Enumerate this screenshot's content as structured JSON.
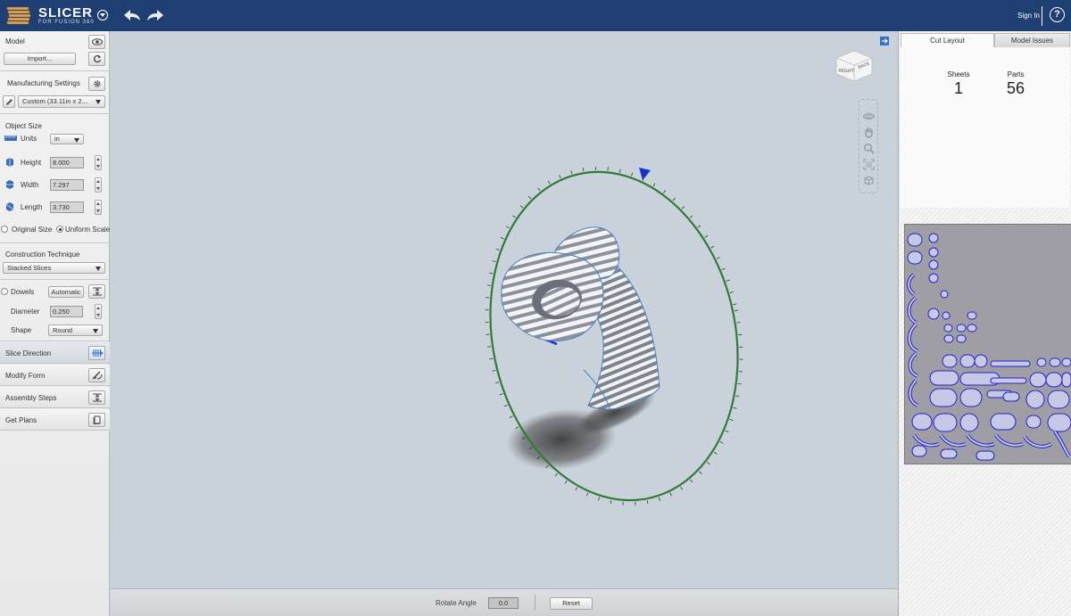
{
  "app": {
    "title": "SLICER",
    "subtitle": "FOR FUSION 360",
    "sign_in": "Sign In",
    "help": "?"
  },
  "left_panel": {
    "model": {
      "label": "Model",
      "import_label": "Import..."
    },
    "manufacturing": {
      "label": "Manufacturing Settings",
      "preset": "Custom (33.11in x 2..."
    },
    "object_size": {
      "label": "Object Size",
      "units_label": "Units",
      "units_value": "in",
      "height_label": "Height",
      "height_value": "8.000",
      "width_label": "Width",
      "width_value": "7.297",
      "length_label": "Length",
      "length_value": "3.730",
      "original_size": "Original Size",
      "uniform_scale": "Uniform Scale"
    },
    "construction": {
      "label": "Construction Technique",
      "value": "Stacked Slices"
    },
    "dowels": {
      "label": "Dowels",
      "mode": "Automatic",
      "diameter_label": "Diameter",
      "diameter_value": "0.250",
      "shape_label": "Shape",
      "shape_value": "Round"
    },
    "nav": [
      {
        "label": "Slice Direction",
        "icon": "slice-direction-icon"
      },
      {
        "label": "Modify Form",
        "icon": "modify-form-icon"
      },
      {
        "label": "Assembly Steps",
        "icon": "assembly-steps-icon"
      },
      {
        "label": "Get Plans",
        "icon": "get-plans-icon"
      }
    ]
  },
  "viewport": {
    "viewcube": {
      "right": "RIGHT",
      "back": "BACK"
    },
    "rotate_label": "Rotate Angle",
    "rotate_value": "0.0",
    "reset_label": "Reset"
  },
  "right_panel": {
    "tabs": [
      "Cut Layout",
      "Model Issues"
    ],
    "sheets_label": "Sheets",
    "sheets_value": "1",
    "parts_label": "Parts",
    "parts_value": "56"
  },
  "colors": {
    "topbar": "#1f3f73",
    "ring": "#2e7d32",
    "accent": "#2f6fd0",
    "part_fill": "#c7c7e6",
    "part_outline": "#2020d0",
    "part_number": "#e02020"
  }
}
